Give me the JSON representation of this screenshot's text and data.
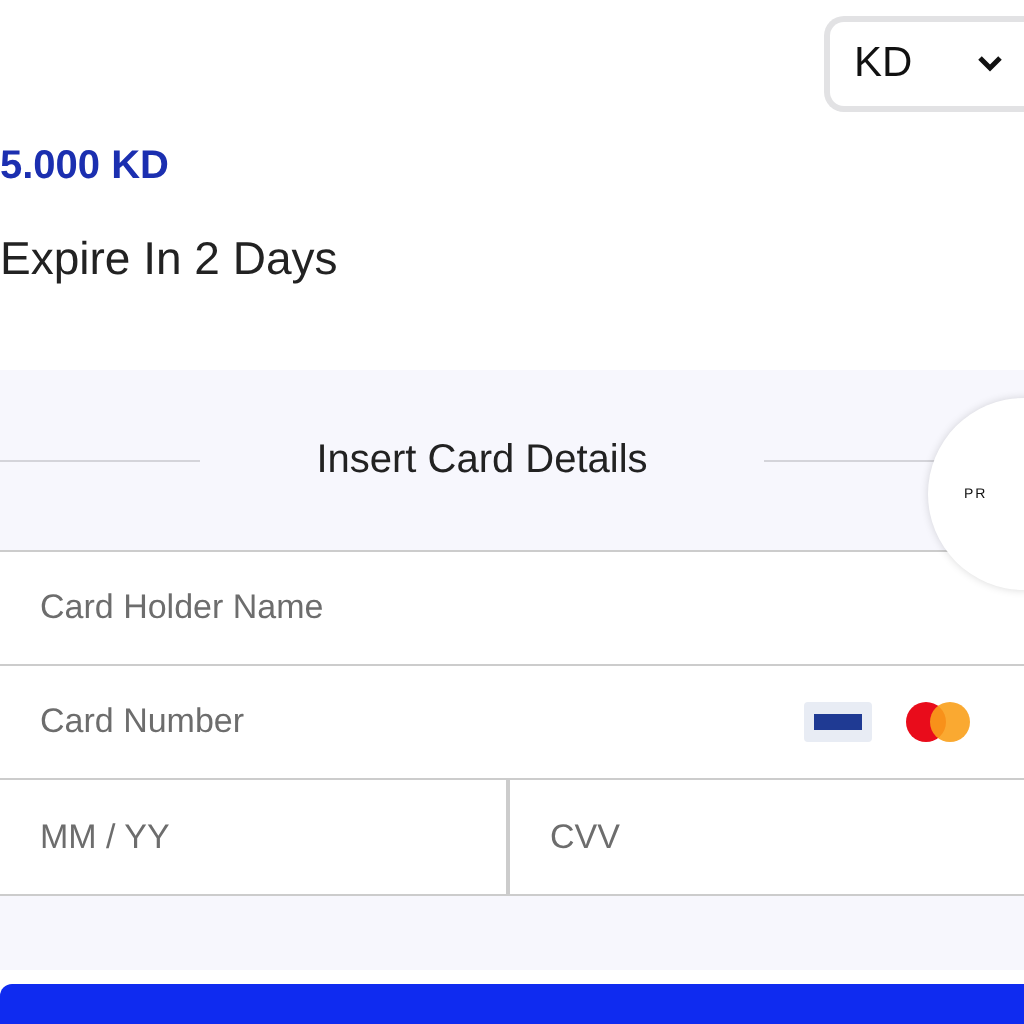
{
  "currency_selector": {
    "value": "KD"
  },
  "amount": "5.000 KD",
  "expiry": "Expire In 2 Days",
  "card_form": {
    "title": "Insert Card Details",
    "badge": "PR",
    "fields": [
      {
        "placeholder": "Card Holder Name"
      },
      {
        "placeholder": "Card Number"
      },
      {
        "placeholder": "MM / YY"
      },
      {
        "placeholder": "CVV"
      }
    ]
  }
}
